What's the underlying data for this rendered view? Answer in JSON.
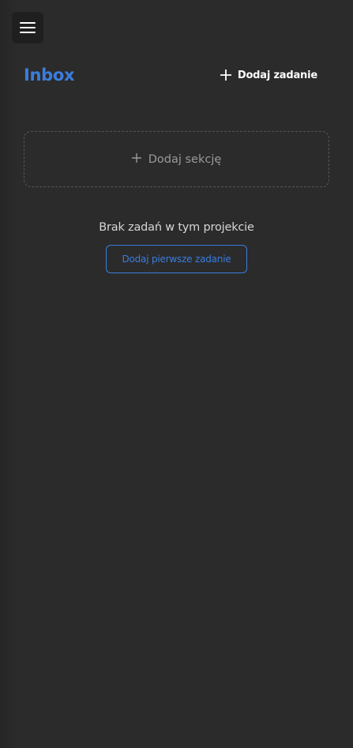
{
  "header": {
    "title": "Inbox",
    "add_task_label": "Dodaj zadanie"
  },
  "add_section": {
    "label": "Dodaj sekcję"
  },
  "empty_state": {
    "message": "Brak zadań w tym projekcie",
    "button_label": "Dodaj pierwsze zadanie"
  },
  "icons": {
    "menu": "hamburger-menu-icon",
    "add_task": "plus-icon",
    "add_section": "plus-icon"
  },
  "colors": {
    "accent": "#3b7ddd",
    "background": "#2b2b2b",
    "text_primary": "#ffffff",
    "text_muted": "#9a9a9a"
  }
}
